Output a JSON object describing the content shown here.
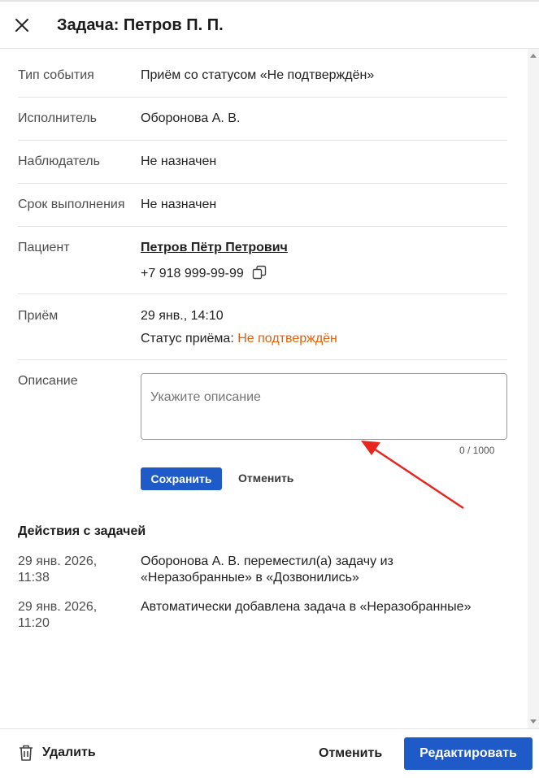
{
  "header": {
    "title": "Задача: Петров П. П."
  },
  "fields": {
    "event_type": {
      "label": "Тип события",
      "value": "Приём со статусом «Не подтверждён»"
    },
    "executor": {
      "label": "Исполнитель",
      "value": "Оборонова А. В."
    },
    "observer": {
      "label": "Наблюдатель",
      "value": "Не назначен"
    },
    "deadline": {
      "label": "Срок выполнения",
      "value": "Не назначен"
    },
    "patient": {
      "label": "Пациент",
      "name": "Петров Пётр Петрович",
      "phone": "+7 918 999-99-99"
    },
    "appointment": {
      "label": "Приём",
      "date": "29 янв., 14:10",
      "status_label": "Статус приёма:",
      "status_value": "Не подтверждён"
    }
  },
  "description": {
    "label": "Описание",
    "placeholder": "Укажите описание",
    "counter": "0 / 1000",
    "save_label": "Сохранить",
    "cancel_label": "Отменить"
  },
  "actions": {
    "title": "Действия с задачей",
    "log": [
      {
        "date": "29 янв. 2026, 11:38",
        "text": "Оборонова А. В. переместил(а) задачу из «Неразобранные» в «Дозвонились»"
      },
      {
        "date": "29 янв. 2026, 11:20",
        "text": "Автоматически добавлена задача в «Неразобранные»"
      }
    ]
  },
  "footer": {
    "delete_label": "Удалить",
    "cancel_label": "Отменить",
    "edit_label": "Редактировать"
  },
  "colors": {
    "accent": "#1f5bc8",
    "status_warning": "#e1600a",
    "annotation_arrow": "#e8261e"
  }
}
